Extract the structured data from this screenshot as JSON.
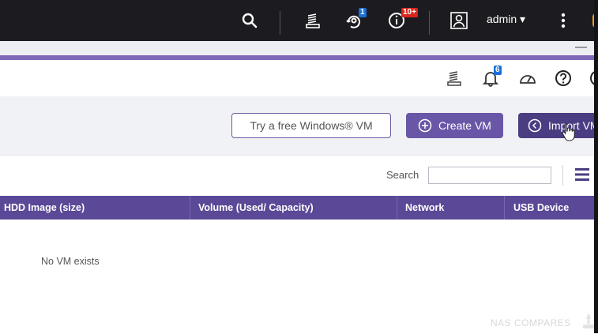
{
  "topbar": {
    "user": "admin ▾",
    "notifications_badge": "1",
    "events_badge": "10+",
    "icons": [
      "search-icon",
      "task-stack-icon",
      "notification-icon",
      "info-icon",
      "user-icon",
      "more-vertical-icon"
    ]
  },
  "window": {
    "minimize_label": "—"
  },
  "toolbar": {
    "alerts_badge": "6",
    "icons": [
      "task-stack-icon",
      "bell-icon",
      "resource-monitor-icon",
      "help-icon"
    ]
  },
  "actions": {
    "try_windows": "Try a free Windows® VM",
    "create_vm": "Create VM",
    "import_vm": "Import VM"
  },
  "search": {
    "label": "Search",
    "value": "",
    "placeholder": ""
  },
  "table": {
    "columns": [
      "HDD Image (size)",
      "Volume (Used/ Capacity)",
      "Network",
      "USB Device"
    ],
    "empty_message": "No VM exists"
  },
  "watermark": "NAS COMPARES",
  "colors": {
    "accent": "#5b4897",
    "button": "#6a56a6",
    "topbar": "#1c1c20"
  }
}
